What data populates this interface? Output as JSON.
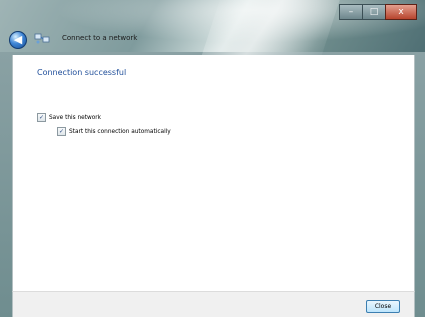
{
  "window": {
    "title": "Connect to a network",
    "caption_buttons": {
      "minimize": "–",
      "maximize": "□",
      "close": "x"
    }
  },
  "content": {
    "heading": "Connection successful",
    "options": [
      {
        "label": "Save this network",
        "checked": true
      },
      {
        "label": "Start this connection automatically",
        "checked": true
      }
    ]
  },
  "footer": {
    "close_label": "Close"
  },
  "colors": {
    "heading": "#1f4e9a",
    "accent": "#3f86d6"
  },
  "icons": {
    "back": "back-arrow-icon",
    "network": "network-icon",
    "check": "checkmark-icon"
  }
}
